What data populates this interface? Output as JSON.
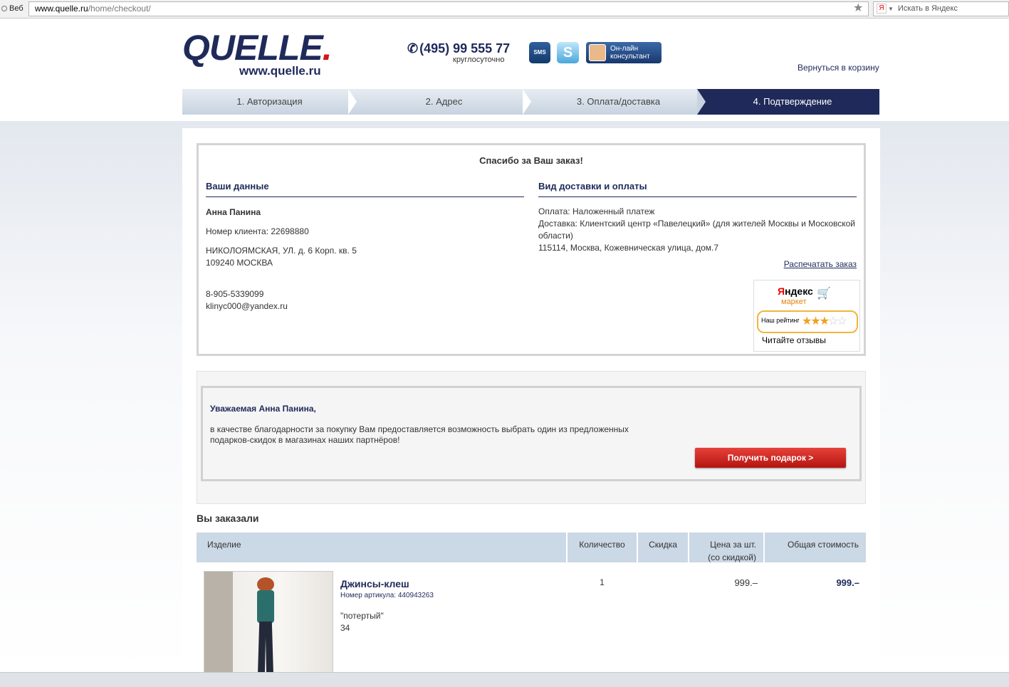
{
  "browser": {
    "tab_label": "Веб",
    "url_host": "www.quelle.ru",
    "url_path": "/home/checkout/",
    "search_placeholder": "Искать в Яндекс",
    "search_engine_glyph": "Я"
  },
  "header": {
    "logo_text": "QUELLE",
    "logo_dot": ".",
    "logo_url": "www.quelle.ru",
    "phone": "(495) 99 555 77",
    "phone_note": "круглосуточно",
    "sms_label": "SMS",
    "skype_label": "S",
    "consultant_line1": "Он-лайн",
    "consultant_line2": "консультант",
    "back_to_cart": "Вернуться в корзину"
  },
  "steps": [
    {
      "label": "1. Авторизация"
    },
    {
      "label": "2. Адрес"
    },
    {
      "label": "3. Оплата/доставка"
    },
    {
      "label": "4. Подтверждение"
    }
  ],
  "confirmation": {
    "thanks": "Спасибо за Ваш заказ!",
    "your_data_title": "Ваши данные",
    "customer_name": "Анна Панина",
    "client_number": "Номер клиента: 22698880",
    "address_line1": "НИКОЛОЯМСКАЯ, УЛ. д. 6 Корп. кв. 5",
    "address_line2": "109240 МОСКВА",
    "phone": "8-905-5339099",
    "email": "klinyc000@yandex.ru",
    "delivery_title": "Вид доставки и оплаты",
    "payment": "Оплата: Наложенный платеж",
    "delivery": "Доставка: Клиентский центр «Павелецкий» (для жителей Москвы и Московской области)",
    "delivery_address": "115114, Москва, Кожевническая улица, дом.7",
    "print_order": "Распечатать заказ"
  },
  "yandex_market": {
    "brand_first": "Я",
    "brand_rest": "ндекс",
    "subtitle": "маркет",
    "rating_label": "Наш рейтинг",
    "rating": 3,
    "rating_max": 5,
    "reviews_link": "Читайте отзывы"
  },
  "gift": {
    "greeting": "Уважаемая Анна Панина,",
    "text": "в качестве благодарности за покупку Вам предоставляется возможность выбрать один из предложенных подарков-скидок в магазинах наших партнёров!",
    "button": "Получить подарок >"
  },
  "order": {
    "title": "Вы заказали",
    "columns": {
      "item": "Изделие",
      "qty": "Количество",
      "discount": "Скидка",
      "unit_price_line1": "Цена за шт.",
      "unit_price_line2": "(со скидкой)",
      "total": "Общая стоимость"
    },
    "rows": [
      {
        "name": "Джинсы-клеш",
        "article": "Номер артикула: 440943263",
        "variant": "\"потертый\"",
        "size": "34",
        "qty": "1",
        "discount": "",
        "unit_price": "999.–",
        "total": "999.–"
      }
    ]
  }
}
